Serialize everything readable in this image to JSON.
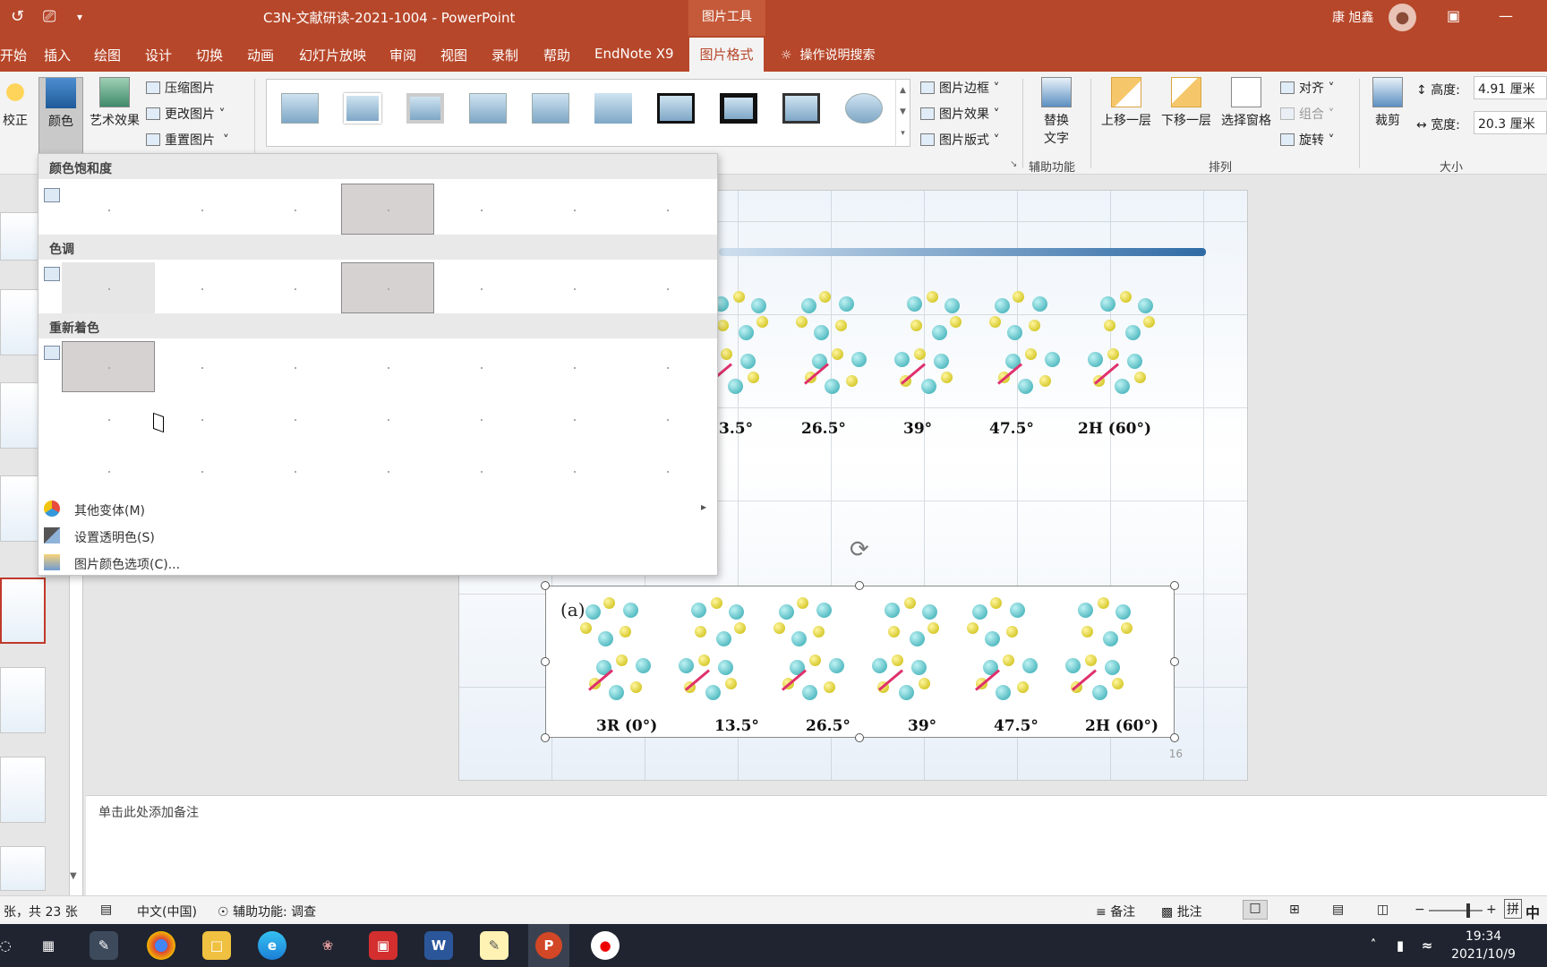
{
  "titlebar": {
    "doc_title": "C3N-文献研读-2021-1004  -  PowerPoint",
    "tools_label": "图片工具",
    "user_name": "康 旭鑫",
    "qa_undo": "↺",
    "qa_present": "⎚",
    "qa_more": "▾"
  },
  "tabs": {
    "items": [
      "开始",
      "插入",
      "绘图",
      "设计",
      "切换",
      "动画",
      "幻灯片放映",
      "审阅",
      "视图",
      "录制",
      "帮助",
      "EndNote X9"
    ],
    "active": "图片格式",
    "tell_me": "操作说明搜索"
  },
  "ribbon": {
    "correct": "校正",
    "color": "颜色",
    "art": "艺术效果",
    "compress": "压缩图片",
    "change": "更改图片",
    "reset": "重置图片",
    "border": "图片边框",
    "effect": "图片效果",
    "layout": "图片版式",
    "alt_text_1": "替换",
    "alt_text_2": "文字",
    "accessibility_group": "辅助功能",
    "bring_forward": "上移一层",
    "send_backward": "下移一层",
    "selection_pane": "选择窗格",
    "align": "对齐",
    "group": "组合",
    "rotate": "旋转",
    "arrange_group": "排列",
    "crop": "裁剪",
    "height_label": "高度:",
    "height_value": "4.91 厘米",
    "width_label": "宽度:",
    "width_value": "20.3 厘米",
    "size_group": "大小"
  },
  "color_menu": {
    "saturation_heading": "颜色饱和度",
    "tone_heading": "色调",
    "recolor_heading": "重新着色",
    "more_variations": "其他变体(M)",
    "set_transparent": "设置透明色(S)",
    "color_options": "图片颜色选项(C)..."
  },
  "slide": {
    "top_labels": [
      "3.5°",
      "26.5°",
      "39°",
      "47.5°",
      "2H (60°)"
    ],
    "bottom_labels": [
      "3R (0°)",
      "13.5°",
      "26.5°",
      "39°",
      "47.5°",
      "2H (60°)"
    ],
    "panel_letter": "(a)",
    "slide_number": "16"
  },
  "notes": {
    "placeholder": "单击此处添加备注"
  },
  "status": {
    "slide_count": "张，共 23 张",
    "language": "中文(中国)",
    "accessibility": "辅助功能: 调查",
    "notes": "备注",
    "comments": "批注",
    "ime_1": "拼",
    "ime_2": "中"
  },
  "taskbar": {
    "time": "19:34",
    "date": "2021/10/9"
  },
  "colors": {
    "accent": "#b7472a",
    "ribbon_bg": "#f3f3f3"
  }
}
